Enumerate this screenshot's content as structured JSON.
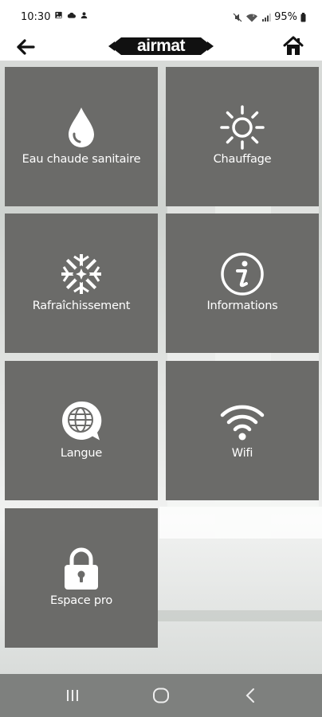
{
  "status_bar": {
    "time": "10:30",
    "battery": "95%",
    "left_icons": [
      "gallery-icon",
      "cloud-icon",
      "person-icon"
    ],
    "right_icons": [
      "mute-icon",
      "wifi-signal-icon",
      "cell-signal-icon",
      "battery-icon"
    ]
  },
  "header": {
    "logo_text": "airmat",
    "back_icon": "arrow-left-icon",
    "home_icon": "home-icon"
  },
  "tiles": [
    {
      "label": "Eau chaude sanitaire",
      "icon": "water-drop-icon"
    },
    {
      "label": "Chauffage",
      "icon": "sun-icon"
    },
    {
      "label": "Rafraîchissement",
      "icon": "snowflake-icon"
    },
    {
      "label": "Informations",
      "icon": "info-icon"
    },
    {
      "label": "Langue",
      "icon": "globe-bubble-icon"
    },
    {
      "label": "Wifi",
      "icon": "wifi-icon"
    },
    {
      "label": "Espace pro",
      "icon": "lock-icon"
    }
  ],
  "navbar": {
    "icons": [
      "recent-apps-icon",
      "home-circle-icon",
      "back-chevron-icon"
    ]
  },
  "colors": {
    "tile": "#6b6b69",
    "tile_text": "#ffffff",
    "header_bg": "#ffffff",
    "logo_bg": "#111111"
  }
}
